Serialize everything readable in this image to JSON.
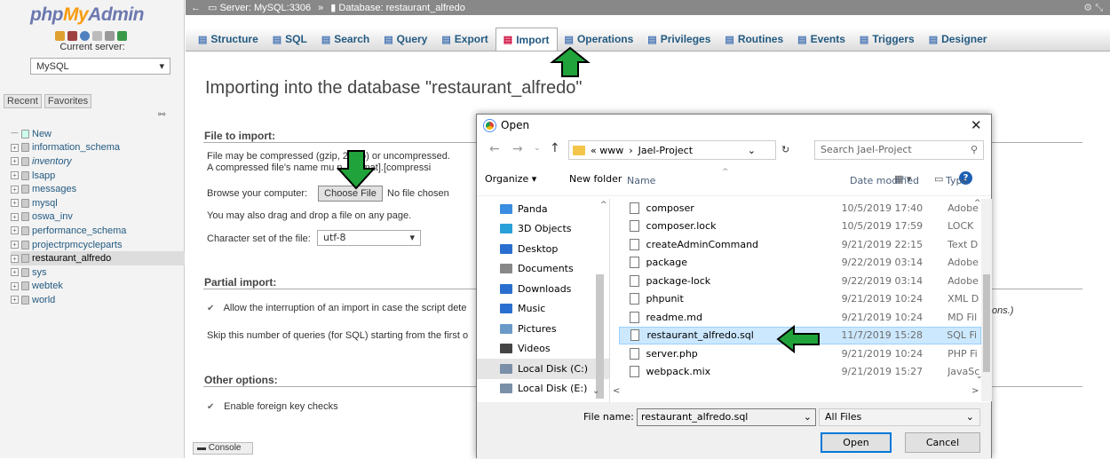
{
  "sidebar": {
    "logo": {
      "php": "php",
      "my": "My",
      "admin": "Admin"
    },
    "current_server_label": "Current server:",
    "server_select": "MySQL",
    "recent_label": "Recent",
    "favorites_label": "Favorites",
    "databases": [
      {
        "name": "New",
        "italic": false
      },
      {
        "name": "information_schema",
        "italic": false
      },
      {
        "name": "inventory",
        "italic": true
      },
      {
        "name": "lsapp",
        "italic": false
      },
      {
        "name": "messages",
        "italic": false
      },
      {
        "name": "mysql",
        "italic": false
      },
      {
        "name": "oswa_inv",
        "italic": false
      },
      {
        "name": "performance_schema",
        "italic": false
      },
      {
        "name": "projectrpmcycleparts",
        "italic": false
      },
      {
        "name": "restaurant_alfredo",
        "italic": false,
        "selected": true
      },
      {
        "name": "sys",
        "italic": false
      },
      {
        "name": "webtek",
        "italic": false
      },
      {
        "name": "world",
        "italic": false
      }
    ]
  },
  "breadcrumb": {
    "server": "Server: MySQL:3306",
    "sep": "»",
    "database": "Database: restaurant_alfredo"
  },
  "tabs": [
    {
      "label": "Structure",
      "icon": "structure-icon"
    },
    {
      "label": "SQL",
      "icon": "sql-icon"
    },
    {
      "label": "Search",
      "icon": "search-icon"
    },
    {
      "label": "Query",
      "icon": "query-icon"
    },
    {
      "label": "Export",
      "icon": "export-icon"
    },
    {
      "label": "Import",
      "icon": "import-icon",
      "active": true
    },
    {
      "label": "Operations",
      "icon": "wrench-icon"
    },
    {
      "label": "Privileges",
      "icon": "privileges-icon"
    },
    {
      "label": "Routines",
      "icon": "routines-icon"
    },
    {
      "label": "Events",
      "icon": "clock-icon"
    },
    {
      "label": "Triggers",
      "icon": "triggers-icon"
    },
    {
      "label": "Designer",
      "icon": "designer-icon"
    }
  ],
  "main": {
    "title": "Importing into the database \"restaurant_alfredo\"",
    "file_section": "File to import:",
    "compress_line1": "File may be compressed (gzip,      2, zip) or uncompressed.",
    "compress_line2": "A compressed file's name mu        n .[format].[compressi",
    "browse_label": "Browse your computer:",
    "choose_file": "Choose File",
    "no_file": "No file chosen",
    "drag_text": "You may also drag and drop a file on any page.",
    "charset_label": "Character set of the file:",
    "charset_value": "utf-8",
    "partial_section": "Partial import:",
    "allow_interrupt": "Allow the interruption of an import in case the script dete",
    "allow_interrupt_tail": "ons.)",
    "skip_queries": "Skip this number of queries (for SQL) starting from the first o",
    "other_section": "Other options:",
    "foreign_keys": "Enable foreign key checks",
    "console": "Console"
  },
  "dialog": {
    "title": "Open",
    "address": [
      "« www",
      "›",
      "Jael-Project"
    ],
    "search_placeholder": "Search Jael-Project",
    "organize": "Organize ▾",
    "new_folder": "New folder",
    "col_name": "Name",
    "col_date": "Date modified",
    "col_type": "Type",
    "places": [
      {
        "label": "Panda",
        "color": "#3a8de0"
      },
      {
        "label": "3D Objects",
        "color": "#2aa0d8"
      },
      {
        "label": "Desktop",
        "color": "#2a6fcf"
      },
      {
        "label": "Documents",
        "color": "#888888"
      },
      {
        "label": "Downloads",
        "color": "#2a6fcf"
      },
      {
        "label": "Music",
        "color": "#2a6fcf"
      },
      {
        "label": "Pictures",
        "color": "#6a9ac8"
      },
      {
        "label": "Videos",
        "color": "#444444"
      },
      {
        "label": "Local Disk (C:)",
        "color": "#7a8fa8",
        "selected": true
      },
      {
        "label": "Local Disk (E:)",
        "color": "#7a8fa8"
      }
    ],
    "files": [
      {
        "name": "composer",
        "date": "10/5/2019 17:40",
        "type": "Adobe"
      },
      {
        "name": "composer.lock",
        "date": "10/5/2019 17:59",
        "type": "LOCK"
      },
      {
        "name": "createAdminCommand",
        "date": "9/21/2019 22:15",
        "type": "Text D"
      },
      {
        "name": "package",
        "date": "9/22/2019 03:14",
        "type": "Adobe"
      },
      {
        "name": "package-lock",
        "date": "9/22/2019 03:14",
        "type": "Adobe"
      },
      {
        "name": "phpunit",
        "date": "9/21/2019 10:24",
        "type": "XML D"
      },
      {
        "name": "readme.md",
        "date": "9/21/2019 10:24",
        "type": "MD Fil"
      },
      {
        "name": "restaurant_alfredo.sql",
        "date": "11/7/2019 15:28",
        "type": "SQL Fi",
        "selected": true
      },
      {
        "name": "server.php",
        "date": "9/21/2019 10:24",
        "type": "PHP Fi"
      },
      {
        "name": "webpack.mix",
        "date": "9/21/2019 15:27",
        "type": "JavaSc"
      }
    ],
    "file_name_label": "File name:",
    "file_name_value": "restaurant_alfredo.sql",
    "file_type": "All Files",
    "open_btn": "Open",
    "cancel_btn": "Cancel"
  },
  "colors": {
    "accent_arrow": "#1fa33a",
    "arrow_outline": "#000000",
    "link": "#235a81"
  }
}
